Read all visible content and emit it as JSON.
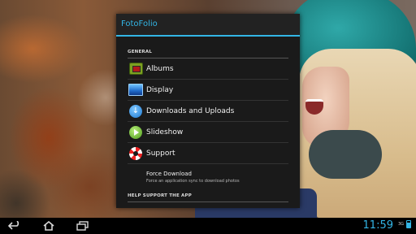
{
  "dialog": {
    "title": "FotoFolio",
    "sections": {
      "general": "GENERAL",
      "help": "HELP SUPPORT THE APP"
    },
    "items": [
      {
        "label": "Albums",
        "icon": "albums-icon"
      },
      {
        "label": "Display",
        "icon": "display-icon"
      },
      {
        "label": "Downloads and Uploads",
        "icon": "download-icon"
      },
      {
        "label": "Slideshow",
        "icon": "play-icon"
      },
      {
        "label": "Support",
        "icon": "lifebuoy-icon"
      }
    ],
    "force_download": {
      "title": "Force Download",
      "subtitle": "Force an application sync to download photos"
    }
  },
  "navbar": {
    "buttons": [
      "back-icon",
      "home-icon",
      "recent-apps-icon"
    ],
    "clock": "11:59",
    "signal": "3G"
  },
  "colors": {
    "accent": "#33b5e5",
    "dialog_bg": "#1a1a1a"
  }
}
